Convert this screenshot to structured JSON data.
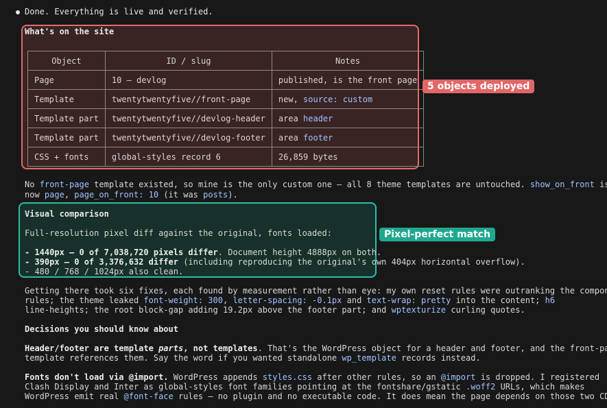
{
  "status": "Done. Everything is live and verified.",
  "site_section": {
    "title": "What's on the site",
    "headers": [
      "Object",
      "ID / slug",
      "Notes"
    ],
    "rows": [
      {
        "object": "Page",
        "id": "10 — devlog",
        "notes_plain": "published, is the front page",
        "notes_key": "",
        "notes_val": ""
      },
      {
        "object": "Template",
        "id": "twentytwentyfive//front-page",
        "notes_plain": "new, ",
        "notes_key": "source:",
        "notes_val": "custom"
      },
      {
        "object": "Template part",
        "id": "twentytwentyfive//devlog-header",
        "notes_plain": "area ",
        "notes_key": "",
        "notes_val": "header"
      },
      {
        "object": "Template part",
        "id": "twentytwentyfive//devlog-footer",
        "notes_plain": "area ",
        "notes_key": "",
        "notes_val": "footer"
      },
      {
        "object": "CSS + fonts",
        "id": "global-styles record 6",
        "notes_plain": "26,859 bytes",
        "notes_key": "",
        "notes_val": ""
      }
    ],
    "annotation": "5 objects deployed"
  },
  "para1": {
    "a": "No ",
    "b": "front-page",
    "c": " template existed, so mine is the only custom one — all 8 theme templates are untouched. ",
    "d": "show_on_front",
    "e": " is",
    "f": "now ",
    "g": "page",
    "h": ", ",
    "i": "page_on_front: 10",
    "j": " (it was ",
    "k": "posts",
    "l": ")."
  },
  "visual": {
    "title": "Visual comparison",
    "intro": "Full-resolution pixel diff against the original, fonts loaded:",
    "l1_bold": "- 1440px — 0 of 7,038,720 pixels differ",
    "l1_rest": ". Document height 4888px on both.",
    "l2_bold": "- 390px — 0 of 3,376,632 differ",
    "l2_rest": " (including reproducing the original's own 404px horizontal overflow).",
    "l3": "- 480 / 768 / 1024px also clean.",
    "annotation": "Pixel-perfect match"
  },
  "para2": {
    "l1": "Getting there took six fixes, each found by measurement rather than eye: my own reset rules were outranking the component",
    "l2a": "rules; the theme leaked ",
    "l2b": "font-weight: 300",
    "l2c": ", ",
    "l2d": "letter-spacing: -0.1px",
    "l2e": " and ",
    "l2f": "text-wrap: pretty",
    "l2g": " into the content; ",
    "l2h": "h6",
    "l3a": "line-heights; the root block-gap adding 19.2px above the footer part; and ",
    "l3b": "wptexturize",
    "l3c": " curling quotes."
  },
  "decisions": {
    "title": "Decisions you should know about",
    "p1_b1": "Header/footer are template ",
    "p1_em": "parts",
    "p1_b2": ", not templates",
    "p1_rest": ". That's the WordPress object for a header and footer, and the front-page",
    "p1_l2a": "template references them. Say the word if you wanted standalone ",
    "p1_l2b": "wp_template",
    "p1_l2c": " records instead.",
    "p2_b1": "Fonts don't load via ",
    "p2_b2": "@import",
    "p2_b3": ".",
    "p2_r1": " WordPress appends ",
    "p2_r2": "styles.css",
    "p2_r3": " after other rules, so an ",
    "p2_r4": "@import",
    "p2_r5": " is dropped. I registered",
    "p2_l2a": "Clash Display and Inter as global-styles font families pointing at the fontshare/gstatic ",
    "p2_l2b": ".woff2",
    "p2_l2c": " URLs, which makes",
    "p2_l3a": "WordPress emit real ",
    "p2_l3b": "@font-face",
    "p2_l3c": " rules — no plugin and no executable code. It does mean the page depends on those two CDNs."
  }
}
